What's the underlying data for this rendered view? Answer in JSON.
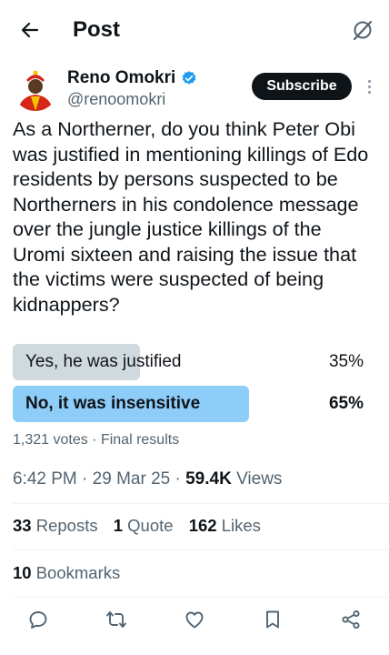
{
  "header": {
    "title": "Post",
    "back_icon": "arrow-left-icon",
    "grok_icon": "grok-icon"
  },
  "author": {
    "name": "Reno Omokri",
    "handle": "@renoomokri",
    "verified": true,
    "subscribe_label": "Subscribe"
  },
  "post": {
    "text": "As a Northerner, do you think Peter Obi was justified in mentioning killings of Edo residents by persons suspected to be Northerners in his condolence message over the jungle justice killings of the Uromi sixteen and raising the issue that the victims were suspected of being kidnappers?"
  },
  "poll": {
    "options": [
      {
        "label": "Yes, he was justified",
        "percent": "35%",
        "value": 35,
        "winner": false
      },
      {
        "label": "No, it was insensitive",
        "percent": "65%",
        "value": 65,
        "winner": true
      }
    ],
    "meta": "1,321 votes · Final results"
  },
  "timestamp": {
    "time": "6:42 PM",
    "date": "29 Mar 25",
    "views_count": "59.4K",
    "views_label": "Views"
  },
  "stats": {
    "reposts_count": "33",
    "reposts_label": "Reposts",
    "quotes_count": "1",
    "quotes_label": "Quote",
    "likes_count": "162",
    "likes_label": "Likes",
    "bookmarks_count": "10",
    "bookmarks_label": "Bookmarks"
  },
  "actions": [
    "reply-icon",
    "repost-icon",
    "like-icon",
    "bookmark-icon",
    "share-icon"
  ],
  "colors": {
    "accent_blue": "#1d9bf0",
    "poll_winner": "#8ecdf8",
    "poll_loser": "#cfd9de",
    "secondary_text": "#536471"
  }
}
